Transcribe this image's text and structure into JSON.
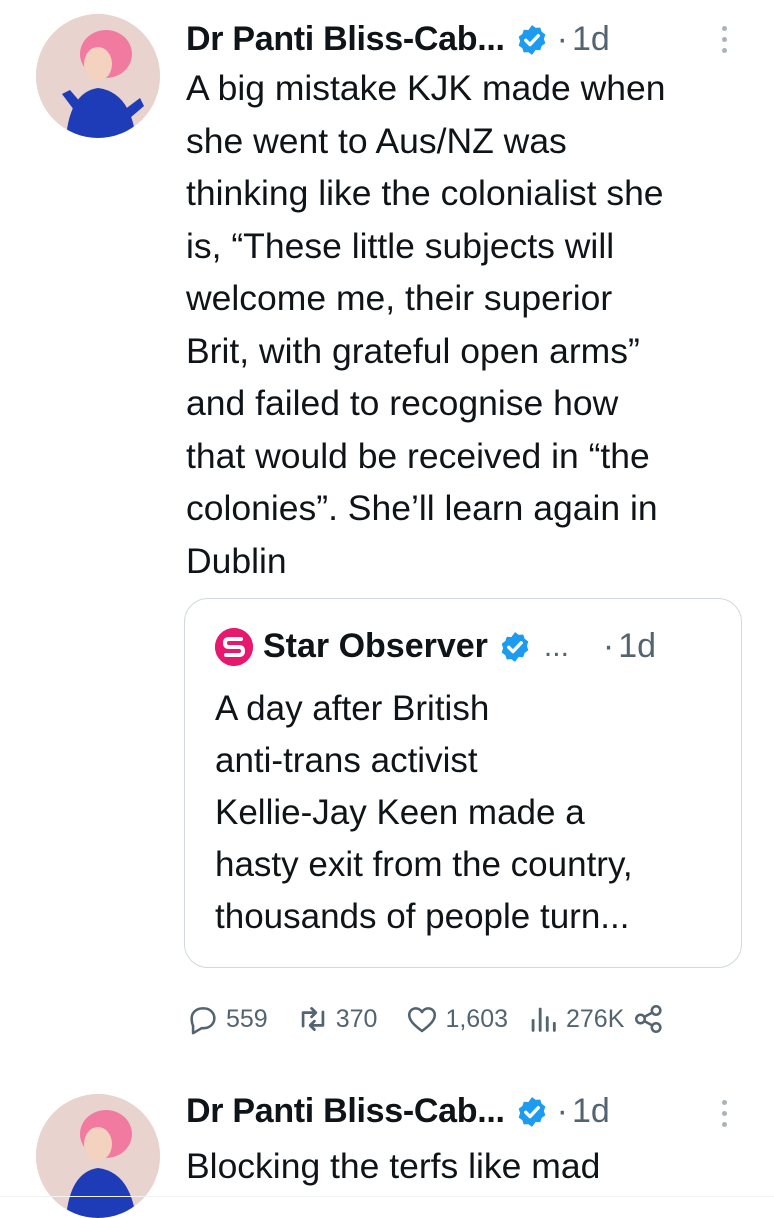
{
  "tweets": [
    {
      "author": "Dr Panti Bliss-Cab...",
      "dot": "·",
      "time": "1d",
      "text": "A big mistake KJK made when\nshe went to Aus/NZ was\nthinking like the colonialist she\nis, “These little subjects will\nwelcome me, their superior\nBrit, with grateful open arms”\nand failed to recognise how\nthat would be received in “the\ncolonies”. She’ll learn again in\nDublin",
      "quote": {
        "author": "Star Observer",
        "ellipsis": "...",
        "dot": "·",
        "time": "1d",
        "text": "A day after British\nanti-trans activist\nKellie-Jay Keen made a\nhasty exit from the country,\nthousands of people turn..."
      },
      "actions": {
        "replies": "559",
        "reposts": "370",
        "likes": "1,603",
        "views": "276K"
      }
    },
    {
      "author": "Dr Panti Bliss-Cab...",
      "dot": "·",
      "time": "1d",
      "text": "Blocking the terfs like mad"
    }
  ],
  "colors": {
    "verified": "#1d9bf0",
    "quote_logo": "#e6196e",
    "muted_text": "#536471"
  },
  "icons": [
    "avatar",
    "verified-badge-icon",
    "more-icon",
    "star-observer-logo-icon",
    "reply-icon",
    "repost-icon",
    "like-icon",
    "views-icon",
    "share-icon"
  ]
}
